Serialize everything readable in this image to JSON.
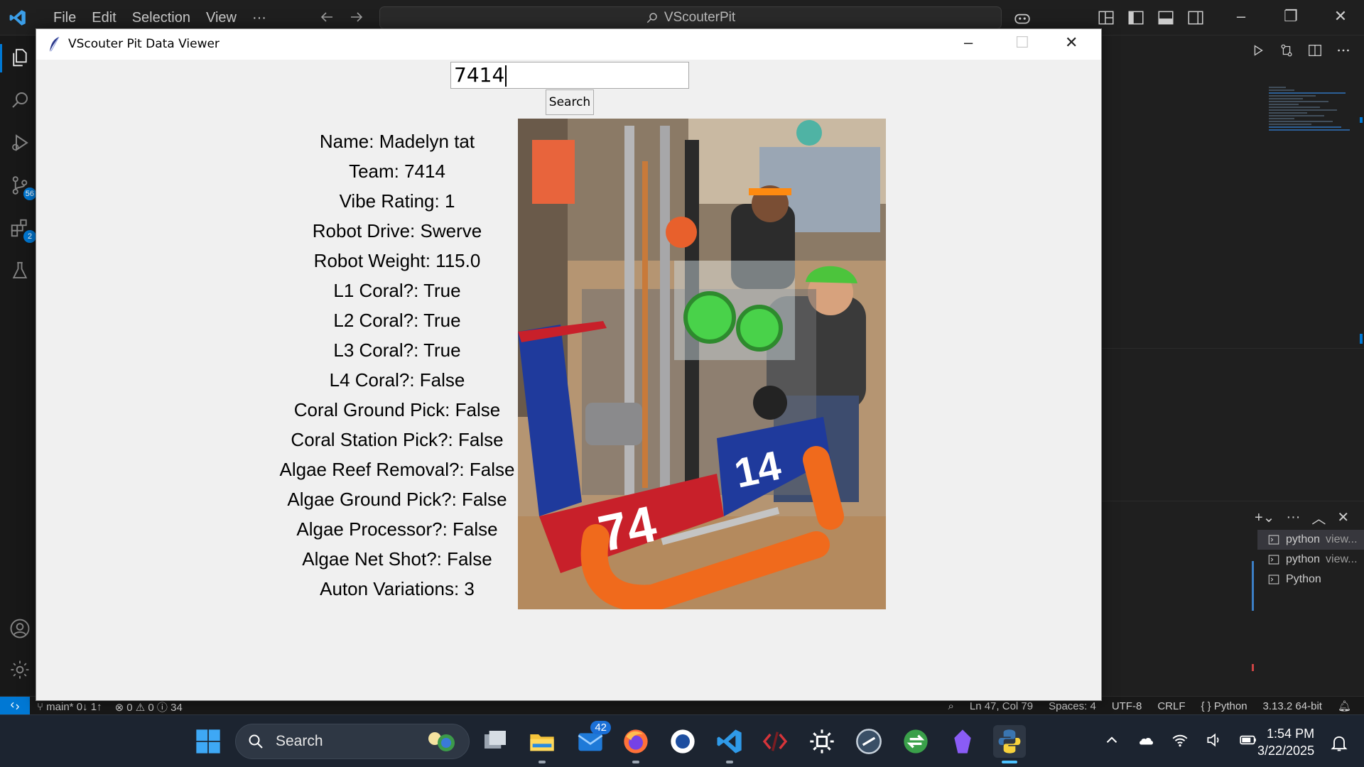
{
  "vscode": {
    "menu": [
      "File",
      "Edit",
      "Selection",
      "View",
      "···"
    ],
    "command_center": "VScouterPit",
    "activity_badges": {
      "source_control": "56",
      "extensions": "2"
    },
    "terminals": [
      {
        "name": "python",
        "suffix": "view..."
      },
      {
        "name": "python",
        "suffix": "view..."
      },
      {
        "name": "Python",
        "suffix": ""
      }
    ],
    "status": {
      "branch": "main*",
      "sync": "0↓ 1↑",
      "problems": "⊗ 0 ⚠ 0 ⓘ 34",
      "position": "Ln 47, Col 79",
      "spaces": "Spaces: 4",
      "encoding": "UTF-8",
      "eol": "CRLF",
      "language": "{ } Python",
      "interpreter": "3.13.2 64-bit"
    }
  },
  "viewer": {
    "title": "VScouter Pit Data Viewer",
    "search_value": "7414",
    "search_button": "Search",
    "fields": [
      "Name: Madelyn tat",
      "Team: 7414",
      "Vibe Rating: 1",
      "Robot Drive: Swerve",
      "Robot Weight: 115.0",
      "L1 Coral?: True",
      "L2 Coral?: True",
      "L3 Coral?: True",
      "L4 Coral?: False",
      "Coral Ground Pick: False",
      "Coral Station Pick?: False",
      "Algae Reef Removal?: False",
      "Algae Ground Pick?: False",
      "Algae Processor?: False",
      "Algae Net Shot?: False",
      "Auton Variations: 3"
    ],
    "photo_bumper_left": "74",
    "photo_bumper_right": "14"
  },
  "taskbar": {
    "search_label": "Search",
    "mail_badge": "42",
    "time": "1:54 PM",
    "date": "3/22/2025"
  },
  "colors": {
    "accent": "#0078d4",
    "tk_bg": "#f0f0f0",
    "bumper_red": "#c8202a",
    "bumper_blue": "#1f3a9c"
  }
}
